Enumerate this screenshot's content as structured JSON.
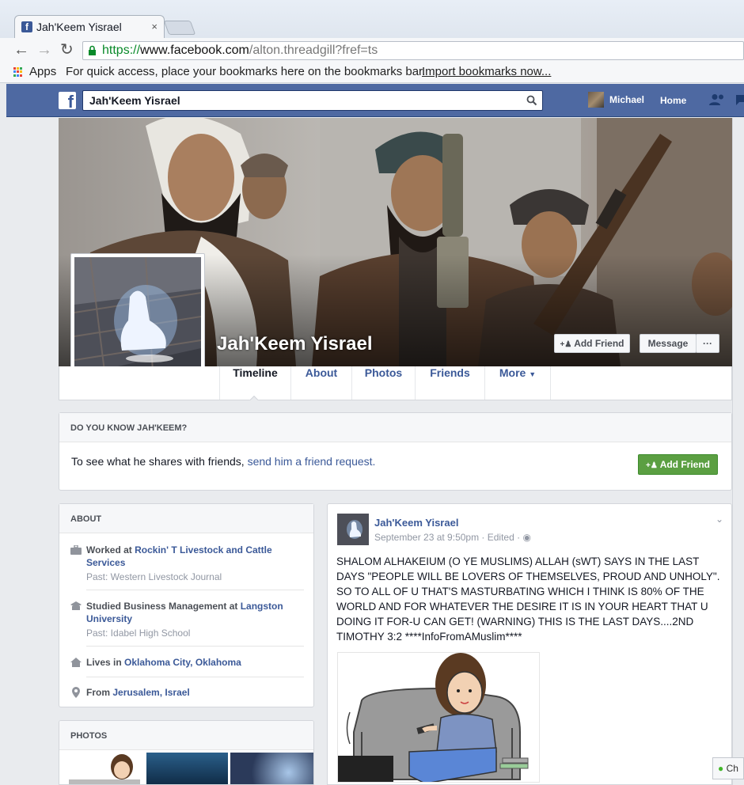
{
  "browser": {
    "tab_title": "Jah'Keem Yisrael",
    "tab_close": "×",
    "url_scheme": "https://",
    "url_host": "www.facebook.com",
    "url_path": "/alton.threadgill?fref=ts",
    "bookmarks": {
      "apps_label": "Apps",
      "hint": "For quick access, place your bookmarks here on the bookmarks bar.",
      "import_link": "Import bookmarks now..."
    }
  },
  "fb_header": {
    "logo": "f",
    "search_value": "Jah'Keem Yisrael",
    "user_name": "Michael",
    "home_label": "Home"
  },
  "profile": {
    "name": "Jah'Keem Yisrael",
    "add_friend_label": "Add Friend",
    "message_label": "Message",
    "more_dots": "···",
    "tabs": [
      "Timeline",
      "About",
      "Photos",
      "Friends",
      "More"
    ]
  },
  "know_card": {
    "heading": "DO YOU KNOW JAH'KEEM?",
    "text": "To see what he shares with friends, ",
    "link": "send him a friend request.",
    "button": "Add Friend"
  },
  "about": {
    "heading": "ABOUT",
    "work_prefix": "Worked at ",
    "work_place": "Rockin' T Livestock and Cattle Services",
    "work_past": "Past: Western Livestock Journal",
    "study_prefix": "Studied Business Management at ",
    "study_place": "Langston University",
    "study_past": "Past: Idabel High School",
    "lives_prefix": "Lives in ",
    "lives_place": "Oklahoma City, Oklahoma",
    "from_prefix": "From ",
    "from_place": "Jerusalem, Israel"
  },
  "photos": {
    "heading": "PHOTOS"
  },
  "post": {
    "author": "Jah'Keem Yisrael",
    "meta": "September 23 at 9:50pm · Edited ·",
    "body": "SHALOM ALHAKEIUM (O YE MUSLIMS) ALLAH (sWT) SAYS IN THE LAST DAYS \"PEOPLE WILL BE LOVERS OF THEMSELVES, PROUD AND UNHOLY\". SO TO ALL OF U THAT'S MASTURBATING WHICH I THINK IS 80% OF THE WORLD AND FOR WHATEVER THE DESIRE IT IS IN YOUR HEART THAT U DOING IT FOR-U CAN GET! (WARNING) THIS IS THE LAST DAYS....2ND TIMOTHY 3:2 ****InfoFromAMuslim****"
  },
  "chat": {
    "label": "Ch"
  },
  "colors": {
    "fb_blue": "#4e69a2",
    "link_blue": "#3b5998",
    "green": "#5b9f42"
  }
}
